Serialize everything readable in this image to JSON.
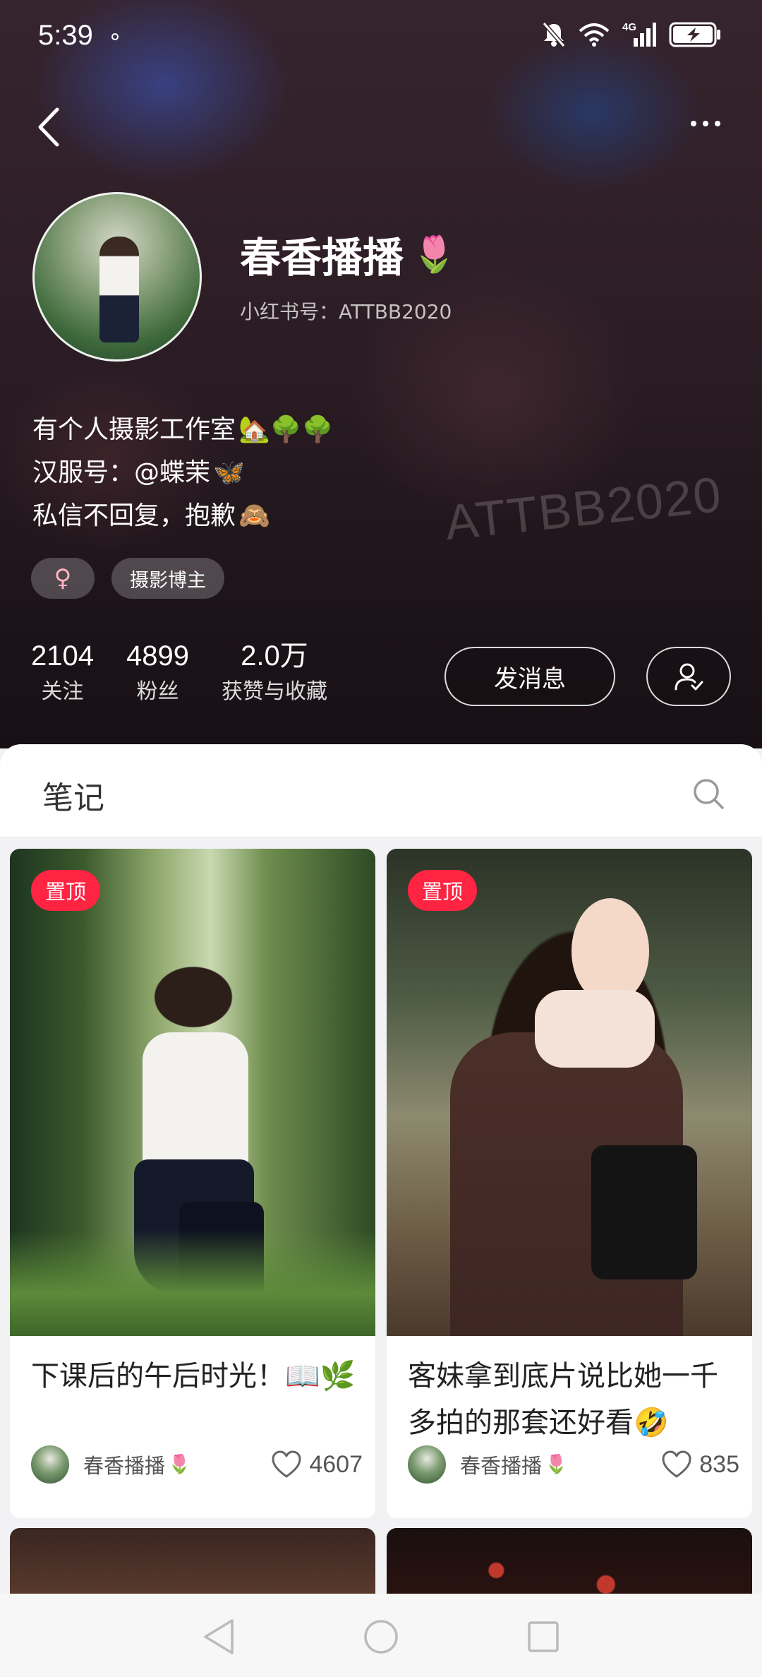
{
  "status_bar": {
    "time": "5:39",
    "network": "4G"
  },
  "profile": {
    "nickname": "春香播播",
    "nickname_emoji": "🌷",
    "redbook_id": "小红书号：ATTBB2020",
    "bio": [
      {
        "text": "有个人摄影工作室",
        "emojis": "🏡🌳🌳"
      },
      {
        "text": "汉服号：@蝶茉",
        "emojis": "🦋"
      },
      {
        "text": "私信不回复，抱歉",
        "emojis": "🙈"
      }
    ],
    "tags": {
      "gender": "♀",
      "category": "摄影博主"
    },
    "stats": [
      {
        "value": "2104",
        "label": "关注"
      },
      {
        "value": "4899",
        "label": "粉丝"
      },
      {
        "value": "2.0万",
        "label": "获赞与收藏"
      }
    ],
    "message_button": "发消息",
    "background_watermark": "ATTBB2020"
  },
  "notes": {
    "section_title": "笔记",
    "cards": [
      {
        "pin_label": "置顶",
        "title": "下课后的午后时光！📖🌿",
        "author": "春香播播",
        "author_emoji": "🌷",
        "likes": "4607"
      },
      {
        "pin_label": "置顶",
        "title": "客妹拿到底片说比她一千多拍的那套还好看🤣",
        "author": "春香播播",
        "author_emoji": "🌷",
        "likes": "835"
      }
    ]
  },
  "colors": {
    "accent": "#ff2442",
    "hero_bg": "#3a2630",
    "page_bg": "#f2f2f4"
  },
  "icons": {
    "back": "chevron-left-icon",
    "more": "more-dots-icon",
    "search": "search-icon",
    "follow": "user-check-icon",
    "like": "heart-icon"
  }
}
